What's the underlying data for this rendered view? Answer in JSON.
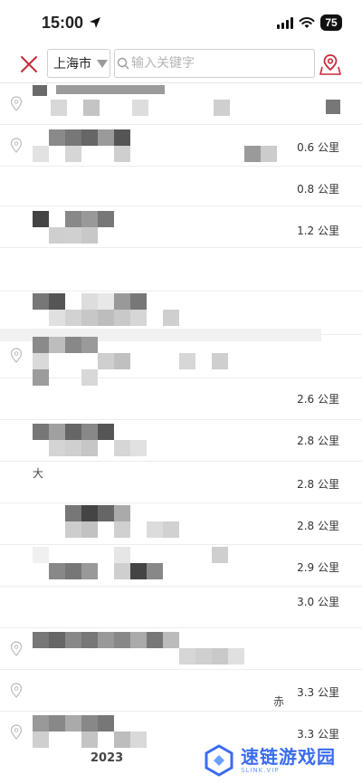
{
  "status": {
    "time": "15:00",
    "battery": "75"
  },
  "search": {
    "city": "上海市",
    "placeholder": "输入关键字"
  },
  "results": [
    {
      "distance": ""
    },
    {
      "distance": "0.6 公里"
    },
    {
      "distance": "0.8 公里"
    },
    {
      "distance": "1.2 公里"
    },
    {
      "distance": ""
    },
    {
      "distance": ""
    },
    {
      "distance": ""
    },
    {
      "distance": "2.6 公里"
    },
    {
      "distance": "2.8 公里"
    },
    {
      "distance": "2.8 公里"
    },
    {
      "distance": "2.8 公里"
    },
    {
      "distance": "2.9 公里"
    },
    {
      "distance": "3.0 公里"
    },
    {
      "distance": ""
    },
    {
      "distance": "3.3 公里"
    },
    {
      "distance": "3.3 公里"
    }
  ],
  "fragments": {
    "da": "大",
    "red": "赤",
    "year": "2023"
  },
  "watermark": {
    "title": "速链游戏园",
    "sub": "SLINK.VIP"
  },
  "colors": {
    "accent": "#c8283b",
    "watermark": "#3b6cf0"
  }
}
